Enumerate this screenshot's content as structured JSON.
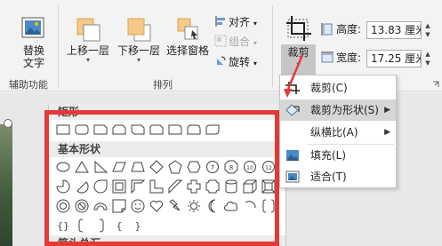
{
  "ribbon": {
    "alt_text_button": {
      "line1": "替换",
      "line2": "文字"
    },
    "accessibility_group": "辅助功能",
    "bring_forward": "上移一层",
    "send_backward": "下移一层",
    "selection_pane": "选择窗格",
    "align": "对齐",
    "group": "组合",
    "rotate": "旋转",
    "arrange_group": "排列",
    "crop_button": "裁剪",
    "height_label": "高度:",
    "height_value": "13.83 厘米",
    "width_label": "宽度:",
    "width_value": "17.25 厘米"
  },
  "crop_menu": {
    "items": [
      {
        "label": "裁剪(C)",
        "icon": "crop-icon",
        "submenu": false
      },
      {
        "label": "裁剪为形状(S)",
        "icon": "crop-to-shape-icon",
        "submenu": true
      },
      {
        "label": "纵横比(A)",
        "icon": "",
        "submenu": true
      },
      {
        "label": "填充(L)",
        "icon": "fill-icon",
        "submenu": false
      },
      {
        "label": "适合(T)",
        "icon": "fit-icon",
        "submenu": false
      }
    ]
  },
  "shapes_gallery": {
    "section_rect": "矩形",
    "section_basic": "基本形状",
    "section_arrows": "箭头总汇",
    "basic_braces": "{ }"
  },
  "colors": {
    "highlight_red": "#e53935",
    "menu_hover": "#d6d6d6",
    "shape_stroke": "#404040"
  }
}
